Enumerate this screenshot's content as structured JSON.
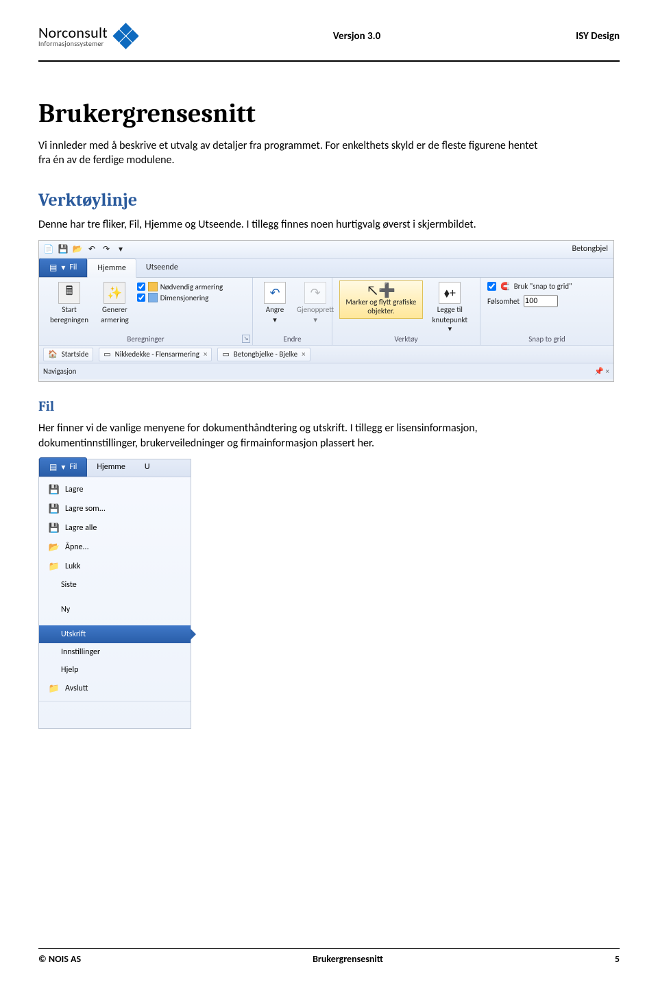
{
  "header": {
    "logo_top": "Norconsult",
    "logo_bottom": "Informasjonssystemer",
    "center": "Versjon 3.0",
    "right": "ISY Design"
  },
  "doc": {
    "title": "Brukergrensesnitt",
    "intro": "Vi innleder med å beskrive et utvalg av detaljer fra programmet. For enkelthets skyld er de fleste figurene hentet fra én av de ferdige modulene.",
    "section1": "Verktøylinje",
    "section1_body": "Denne har tre fliker, Fil, Hjemme og Utseende. I tillegg finnes noen hurtigvalg øverst i skjermbildet.",
    "section2": "Fil",
    "section2_body": "Her finner vi de vanlige menyene for dokumenthåndtering og utskrift. I tillegg er lisensinformasjon, dokumentinnstillinger, brukerveiledninger og firmainformasjon plassert her."
  },
  "ribbon": {
    "title_right": "Betongbjel",
    "tabs": {
      "fil": "Fil",
      "hjemme": "Hjemme",
      "utseende": "Utseende"
    },
    "btn_start1": "Start",
    "btn_start2": "beregningen",
    "btn_generer1": "Generer",
    "btn_generer2": "armering",
    "chk_nodvendig": "Nødvendig armering",
    "chk_dimensjonering": "Dimensjonering",
    "group_beregninger": "Beregninger",
    "btn_angre": "Angre",
    "btn_gjenopprett": "Gjenopprett",
    "group_endre": "Endre",
    "btn_marker1": "Marker og flytt grafiske",
    "btn_marker2": "objekter.",
    "btn_legge1": "Legge til",
    "btn_legge2": "knutepunkt",
    "group_verktoy": "Verktøy",
    "chk_snap": "Bruk \"snap to grid\"",
    "snap_label": "Følsomhet",
    "snap_value": "100",
    "group_snap": "Snap to grid",
    "doc_startside": "Startside",
    "doc_nikkedekke": "Nikkedekke - Flensarmering",
    "doc_betong": "Betongbjelke - Bjelke",
    "nav_label": "Navigasjon"
  },
  "filemenu": {
    "tabs_u": "U",
    "items": [
      "Lagre",
      "Lagre som...",
      "Lagre alle",
      "Åpne...",
      "Lukk",
      "Siste",
      "Ny",
      "Utskrift",
      "Innstillinger",
      "Hjelp",
      "Avslutt"
    ]
  },
  "footer": {
    "left": "© NOIS AS",
    "center": "Brukergrensesnitt",
    "right": "5"
  }
}
